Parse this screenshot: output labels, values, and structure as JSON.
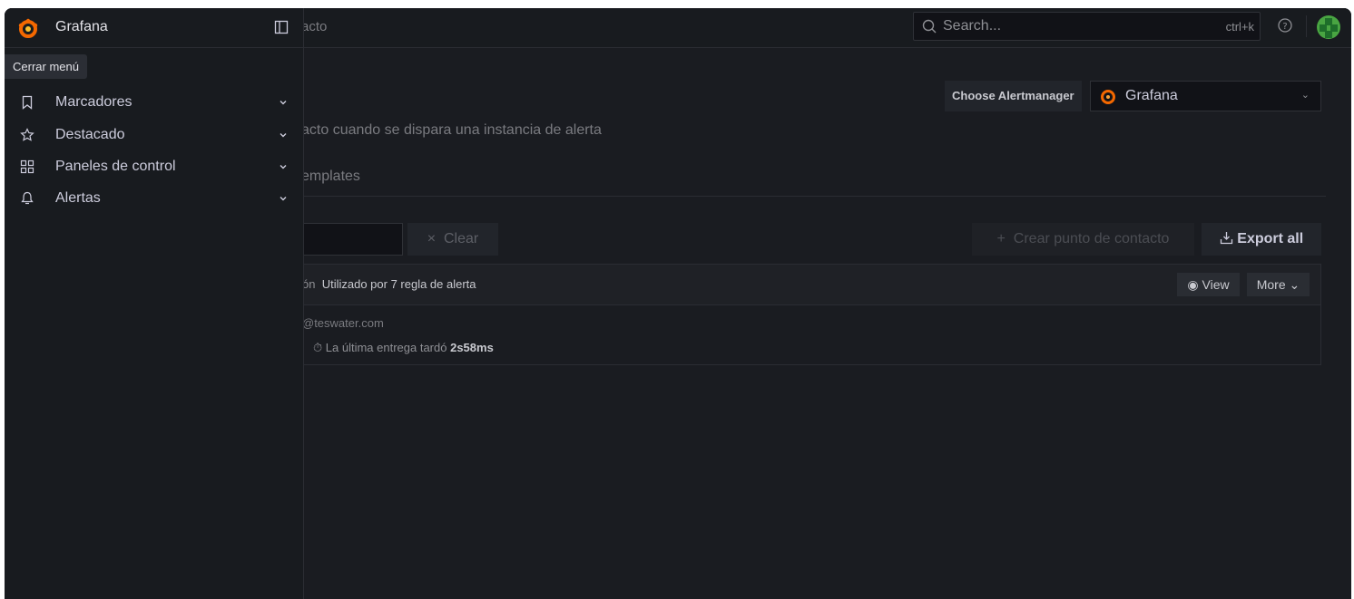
{
  "app": {
    "breadcrumb_fragment": "acto",
    "search": {
      "placeholder": "Search...",
      "shortcut": "ctrl+k"
    }
  },
  "alertmanager": {
    "label": "Choose Alertmanager",
    "selected": "Grafana"
  },
  "page": {
    "subtitle_fragment": "acto cuando se dispara una instancia de alerta",
    "tab_fragment": "emplates"
  },
  "toolbar": {
    "clear_label": "Clear",
    "create_label": "Crear punto de contacto",
    "export_label": "Export all"
  },
  "contact_point": {
    "name_fragment": "ón",
    "usage": "Utilizado por 7 regla de alerta",
    "view_label": "View",
    "more_label": "More",
    "email_fragment": "@teswater.com",
    "delivery_prefix": "La última entrega tardó",
    "delivery_time": "2s58ms"
  },
  "menu": {
    "title": "Grafana",
    "tooltip": "Cerrar menú",
    "items": [
      {
        "label": "Marcadores",
        "icon": "bookmark-icon"
      },
      {
        "label": "Destacado",
        "icon": "star-icon"
      },
      {
        "label": "Paneles de control",
        "icon": "apps-icon"
      },
      {
        "label": "Alertas",
        "icon": "bell-icon"
      }
    ]
  },
  "colors": {
    "brand_orange": "#f46800",
    "avatar_green": "#49a542"
  }
}
